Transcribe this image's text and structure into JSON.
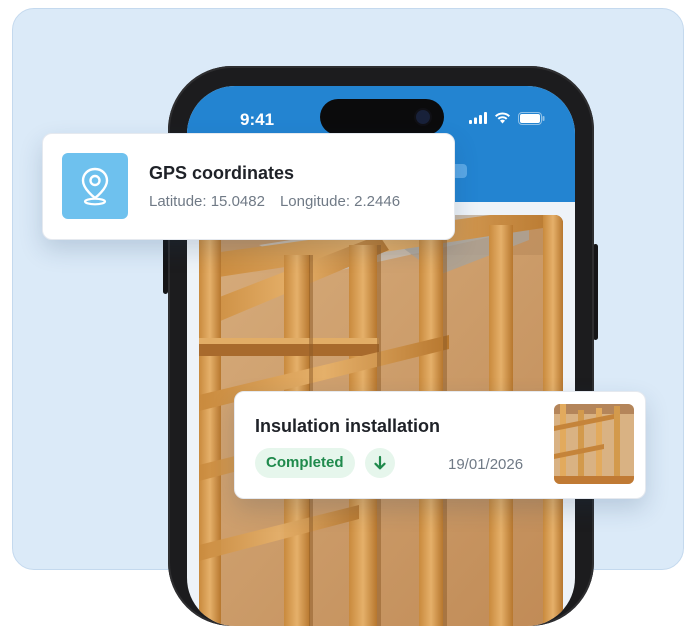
{
  "phone": {
    "status_time": "9:41"
  },
  "gps_card": {
    "title": "GPS coordinates",
    "latitude": "Latitude: 15.0482",
    "longitude": "Longitude: 2.2446",
    "icon": "map-pin-icon"
  },
  "task_card": {
    "title": "Insulation installation",
    "status": "Completed",
    "date": "19/01/2026",
    "icon": "download-arrow-icon"
  },
  "colors": {
    "panel_bg": "#dbeaf8",
    "header_blue": "#2384d1",
    "gps_icon_bg": "#6ec1ee",
    "status_green": "#1f8a4c",
    "status_green_bg": "#e6f6ec"
  }
}
